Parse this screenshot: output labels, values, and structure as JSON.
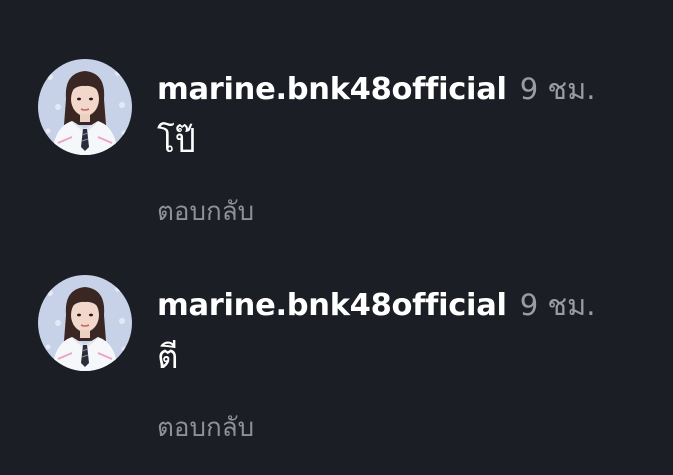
{
  "comments": [
    {
      "username": "marine.bnk48official",
      "time": "9 ชม.",
      "text": "โป๊",
      "reply_label": "ตอบกลับ",
      "avatar_icon": "profile-avatar"
    },
    {
      "username": "marine.bnk48official",
      "time": "9 ชม.",
      "text": "ตี",
      "reply_label": "ตอบกลับ",
      "avatar_icon": "profile-avatar"
    }
  ],
  "colors": {
    "background": "#1b1e24",
    "username": "#ffffff",
    "time": "#9a9ca3",
    "reply": "#8e9097"
  }
}
